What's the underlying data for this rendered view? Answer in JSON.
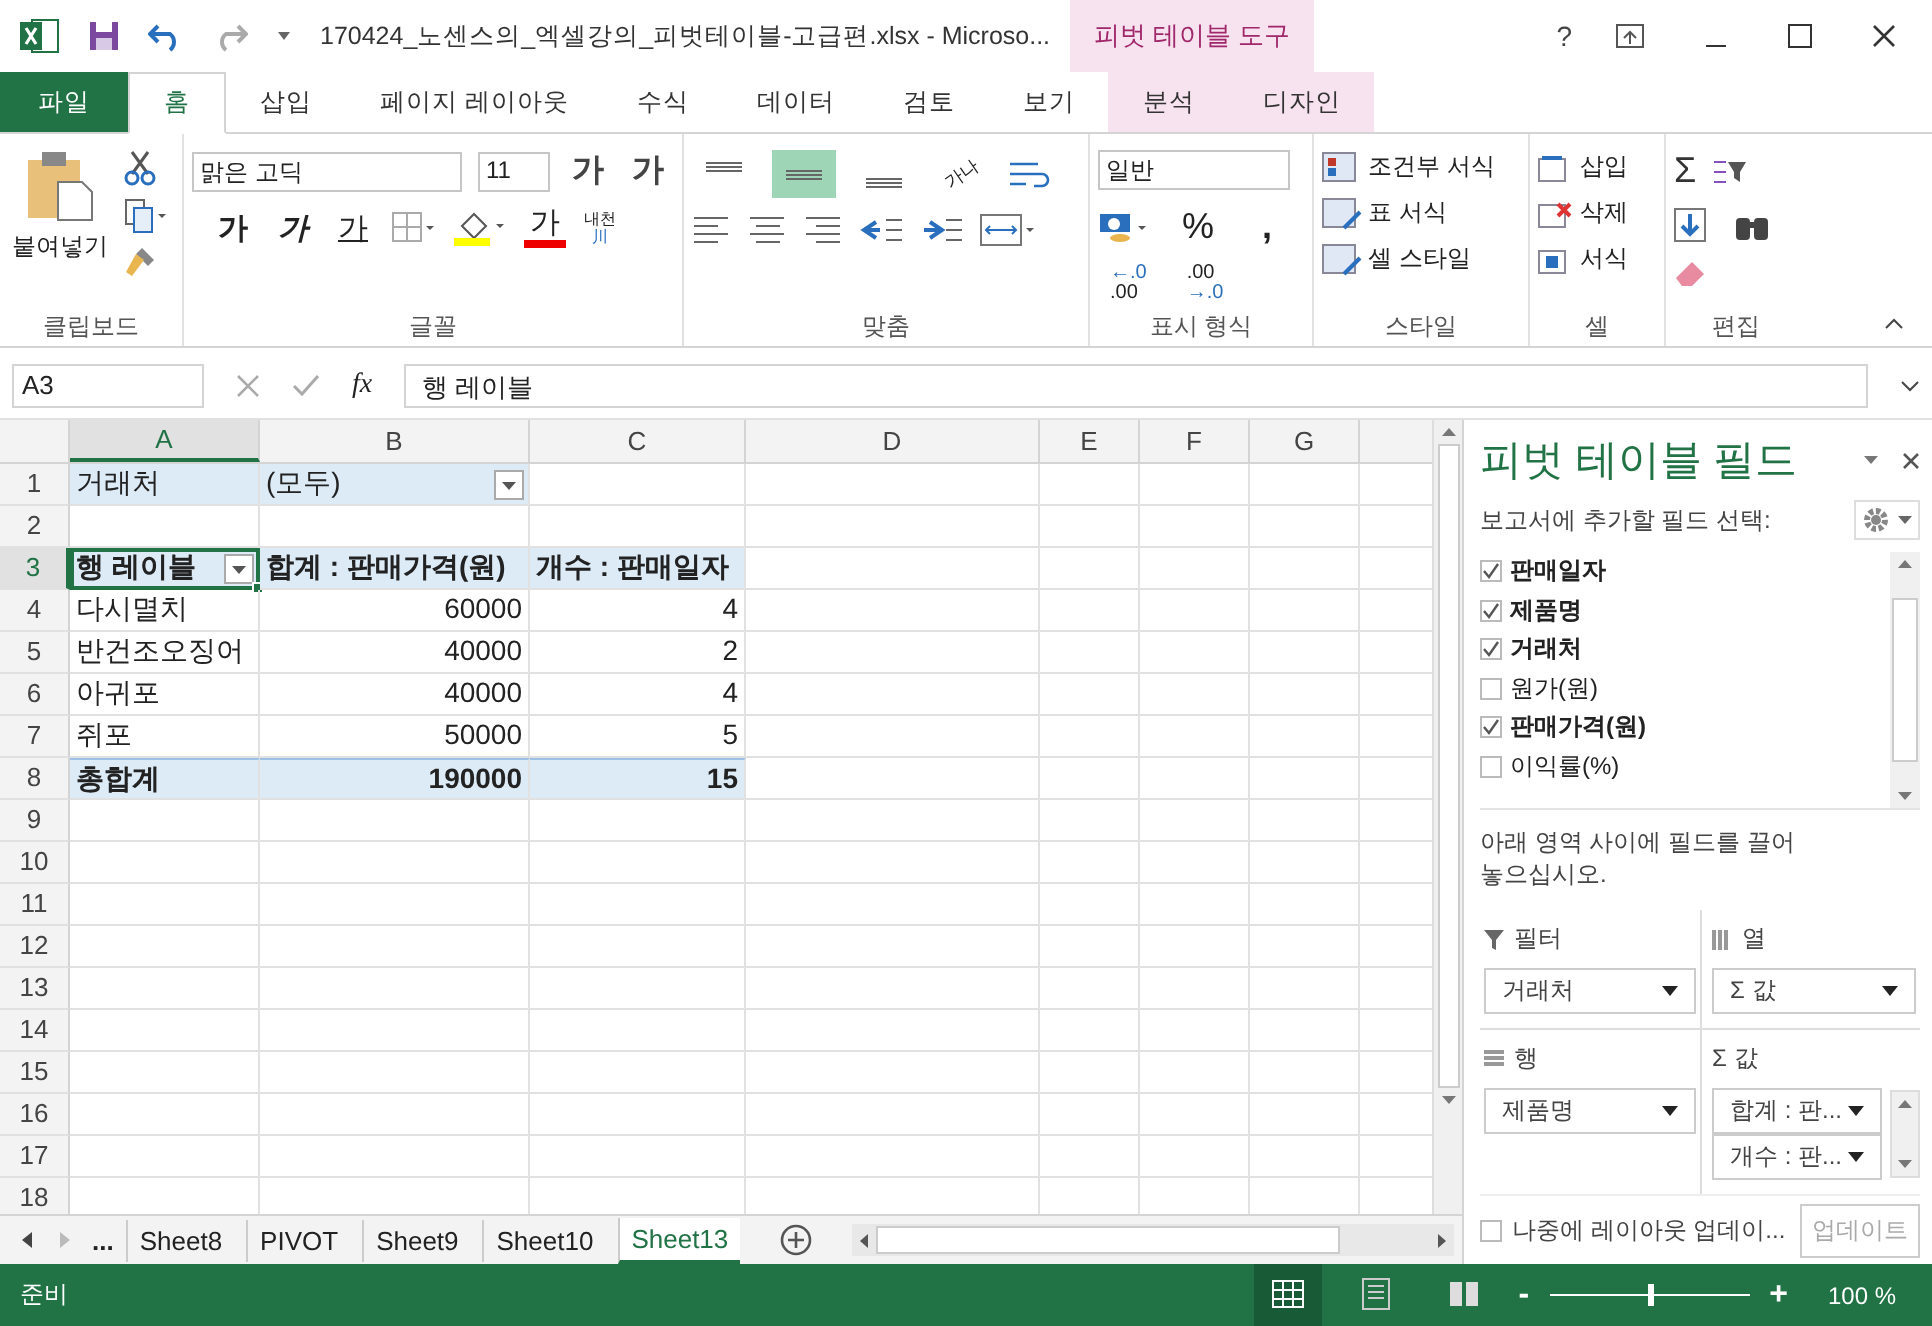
{
  "title_bar": {
    "file_title": "170424_노센스의_엑셀강의_피벗테이블-고급편.xlsx - Microso...",
    "context_group": "피벗 테이블 도구",
    "help": "?"
  },
  "ribbon_tabs": [
    {
      "label": "파일",
      "kind": "file",
      "selected": false
    },
    {
      "label": "홈",
      "kind": "normal",
      "selected": true
    },
    {
      "label": "삽입",
      "kind": "normal",
      "selected": false
    },
    {
      "label": "페이지 레이아웃",
      "kind": "normal",
      "selected": false
    },
    {
      "label": "수식",
      "kind": "normal",
      "selected": false
    },
    {
      "label": "데이터",
      "kind": "normal",
      "selected": false
    },
    {
      "label": "검토",
      "kind": "normal",
      "selected": false
    },
    {
      "label": "보기",
      "kind": "normal",
      "selected": false
    },
    {
      "label": "분석",
      "kind": "context",
      "selected": false
    },
    {
      "label": "디자인",
      "kind": "context",
      "selected": false
    }
  ],
  "ribbon": {
    "clipboard": {
      "paste": "붙여넣기",
      "label": "클립보드"
    },
    "font": {
      "font_name": "맑은 고딕",
      "font_size": "11",
      "grow": "가",
      "shrink": "가",
      "bold": "가",
      "italic": "가",
      "underline": "가",
      "font_color": "가",
      "phonetic": "내천",
      "phonetic_sub": "川",
      "label": "글꼴"
    },
    "alignment": {
      "vertical": [
        {
          "selected": false
        },
        {
          "selected": true
        },
        {
          "selected": false
        }
      ],
      "orientation": "가나",
      "label": "맞춤"
    },
    "number": {
      "format": "일반",
      "percent": "%",
      "comma": ",",
      "increase_decimal": [
        "←.0",
        ".00"
      ],
      "decrease_decimal": [
        ".00",
        "→.0"
      ],
      "label": "표시 형식"
    },
    "styles": {
      "items": [
        "조건부 서식",
        "표 서식",
        "셀 스타일"
      ],
      "label": "스타일"
    },
    "cells": {
      "items": [
        "삽입",
        "삭제",
        "서식"
      ],
      "label": "셀"
    },
    "editing": {
      "sum": "Σ",
      "label": "편집"
    }
  },
  "formula_bar": {
    "name_box": "A3",
    "fx": "fx",
    "formula": "행 레이블"
  },
  "sheet": {
    "columns": [
      {
        "label": "A",
        "selected": true
      },
      {
        "label": "B",
        "selected": false
      },
      {
        "label": "C",
        "selected": false
      },
      {
        "label": "D",
        "selected": false
      },
      {
        "label": "E",
        "selected": false
      },
      {
        "label": "F",
        "selected": false
      },
      {
        "label": "G",
        "selected": false
      }
    ],
    "rows": [
      {
        "number": "1",
        "kind": "filter",
        "selected": false,
        "cells": [
          "거래처",
          "(모두)"
        ]
      },
      {
        "number": "2",
        "selected": false
      },
      {
        "number": "3",
        "kind": "header",
        "selected": true,
        "cells": [
          "행 레이블",
          "합계 : 판매가격(원)",
          "개수 : 판매일자"
        ]
      },
      {
        "number": "4",
        "kind": "item",
        "selected": false,
        "cells": [
          "다시멸치",
          "60000",
          "4"
        ]
      },
      {
        "number": "5",
        "kind": "item",
        "selected": false,
        "cells": [
          "반건조오징어",
          "40000",
          "2"
        ]
      },
      {
        "number": "6",
        "kind": "item",
        "selected": false,
        "cells": [
          "아귀포",
          "40000",
          "4"
        ]
      },
      {
        "number": "7",
        "kind": "item",
        "selected": false,
        "cells": [
          "쥐포",
          "50000",
          "5"
        ]
      },
      {
        "number": "8",
        "kind": "total",
        "selected": false,
        "cells": [
          "총합계",
          "190000",
          "15"
        ]
      },
      {
        "number": "9",
        "selected": false
      },
      {
        "number": "10",
        "selected": false
      },
      {
        "number": "11",
        "selected": false
      },
      {
        "number": "12",
        "selected": false
      },
      {
        "number": "13",
        "selected": false
      },
      {
        "number": "14",
        "selected": false
      },
      {
        "number": "15",
        "selected": false
      },
      {
        "number": "16",
        "selected": false
      },
      {
        "number": "17",
        "selected": false
      },
      {
        "number": "18",
        "selected": false
      }
    ]
  },
  "pivot_pane": {
    "title": "피벗 테이블 필드",
    "subtitle": "보고서에 추가할 필드 선택:",
    "fields": [
      {
        "name": "판매일자",
        "checked": true
      },
      {
        "name": "제품명",
        "checked": true
      },
      {
        "name": "거래처",
        "checked": true
      },
      {
        "name": "원가(원)",
        "checked": false
      },
      {
        "name": "판매가격(원)",
        "checked": true
      },
      {
        "name": "이익률(%)",
        "checked": false
      }
    ],
    "hint": "아래 영역 사이에 필드를 끌어 놓으십시오.",
    "areas": [
      {
        "kind": "filter",
        "label": "필터",
        "items": [
          "거래처"
        ]
      },
      {
        "kind": "columns",
        "label": "열",
        "items": [
          "Σ 값"
        ]
      },
      {
        "kind": "rows",
        "label": "행",
        "items": [
          "제품명"
        ]
      },
      {
        "kind": "values",
        "label": "Σ 값",
        "items": [
          "합계 : 판...",
          "개수 : 판..."
        ]
      }
    ],
    "defer": {
      "label": "나중에 레이아웃 업데이...",
      "checked": false
    },
    "update_button": {
      "label": "업데이트",
      "disabled": true
    }
  },
  "sheet_tabs": {
    "more": "...",
    "tabs": [
      {
        "label": "Sheet8",
        "selected": false
      },
      {
        "label": "PIVOT",
        "selected": false
      },
      {
        "label": "Sheet9",
        "selected": false
      },
      {
        "label": "Sheet10",
        "selected": false
      },
      {
        "label": "Sheet13",
        "selected": true
      }
    ]
  },
  "status_bar": {
    "status": "준비",
    "views": [
      {
        "kind": "normal",
        "selected": true
      },
      {
        "kind": "page-layout",
        "selected": false
      },
      {
        "kind": "page-break",
        "selected": false
      }
    ],
    "zoom": {
      "minus": "-",
      "plus": "+",
      "level": 0.5,
      "label": "100 %"
    }
  }
}
